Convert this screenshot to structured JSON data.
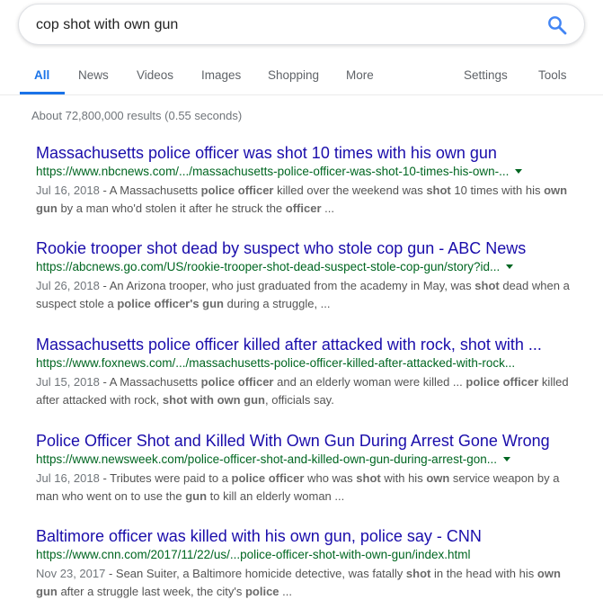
{
  "search": {
    "query": "cop shot with own gun"
  },
  "tabs": {
    "all": "All",
    "news": "News",
    "videos": "Videos",
    "images": "Images",
    "shopping": "Shopping",
    "more": "More",
    "settings": "Settings",
    "tools": "Tools"
  },
  "stats": "About 72,800,000 results (0.55 seconds)",
  "colors": {
    "accent": "#1a73e8",
    "link": "#1a0dab",
    "url": "#006621",
    "snippet": "#545454"
  },
  "icons": {
    "search": "search-icon",
    "dropdown": "caret-down-icon"
  },
  "results": [
    {
      "title": "Massachusetts police officer was shot 10 times with his own gun",
      "url": "https://www.nbcnews.com/.../massachusetts-police-officer-was-shot-10-times-his-own-...",
      "date": "Jul 16, 2018",
      "snippet": [
        {
          "t": "A Massachusetts ",
          "b": false
        },
        {
          "t": "police officer",
          "b": true
        },
        {
          "t": " killed over the weekend was ",
          "b": false
        },
        {
          "t": "shot",
          "b": true
        },
        {
          "t": " 10 times with his ",
          "b": false
        },
        {
          "t": "own gun",
          "b": true
        },
        {
          "t": " by a man who'd stolen it after he struck the ",
          "b": false
        },
        {
          "t": "officer",
          "b": true
        },
        {
          "t": " ...",
          "b": false
        }
      ]
    },
    {
      "title": "Rookie trooper shot dead by suspect who stole cop gun - ABC News",
      "url": "https://abcnews.go.com/US/rookie-trooper-shot-dead-suspect-stole-cop-gun/story?id...",
      "date": "Jul 26, 2018",
      "snippet": [
        {
          "t": "An Arizona trooper, who just graduated from the academy in May, was ",
          "b": false
        },
        {
          "t": "shot",
          "b": true
        },
        {
          "t": " dead when a suspect stole a ",
          "b": false
        },
        {
          "t": "police officer's gun",
          "b": true
        },
        {
          "t": " during a struggle, ...",
          "b": false
        }
      ]
    },
    {
      "title": "Massachusetts police officer killed after attacked with rock, shot with ...",
      "url": "https://www.foxnews.com/.../massachusetts-police-officer-killed-after-attacked-with-rock...",
      "date": "Jul 15, 2018",
      "snippet": [
        {
          "t": "A Massachusetts ",
          "b": false
        },
        {
          "t": "police officer",
          "b": true
        },
        {
          "t": " and an elderly woman were killed ... ",
          "b": false
        },
        {
          "t": "police officer",
          "b": true
        },
        {
          "t": " killed after attacked with rock, ",
          "b": false
        },
        {
          "t": "shot with own gun",
          "b": true
        },
        {
          "t": ", officials say.",
          "b": false
        }
      ]
    },
    {
      "title": "Police Officer Shot and Killed With Own Gun During Arrest Gone Wrong",
      "url": "https://www.newsweek.com/police-officer-shot-and-killed-own-gun-during-arrest-gon...",
      "date": "Jul 16, 2018",
      "snippet": [
        {
          "t": "Tributes were paid to a ",
          "b": false
        },
        {
          "t": "police officer",
          "b": true
        },
        {
          "t": " who was ",
          "b": false
        },
        {
          "t": "shot",
          "b": true
        },
        {
          "t": " with his ",
          "b": false
        },
        {
          "t": "own",
          "b": true
        },
        {
          "t": " service weapon by a man who went on to use the ",
          "b": false
        },
        {
          "t": "gun",
          "b": true
        },
        {
          "t": " to kill an elderly woman ...",
          "b": false
        }
      ]
    },
    {
      "title": "Baltimore officer was killed with his own gun, police say - CNN",
      "url": "https://www.cnn.com/2017/11/22/us/...police-officer-shot-with-own-gun/index.html",
      "date": "Nov 23, 2017",
      "snippet": [
        {
          "t": "Sean Suiter, a Baltimore homicide detective, was fatally ",
          "b": false
        },
        {
          "t": "shot",
          "b": true
        },
        {
          "t": " in the head with his ",
          "b": false
        },
        {
          "t": "own gun",
          "b": true
        },
        {
          "t": " after a struggle last week, the city's ",
          "b": false
        },
        {
          "t": "police",
          "b": true
        },
        {
          "t": " ...",
          "b": false
        }
      ]
    }
  ]
}
